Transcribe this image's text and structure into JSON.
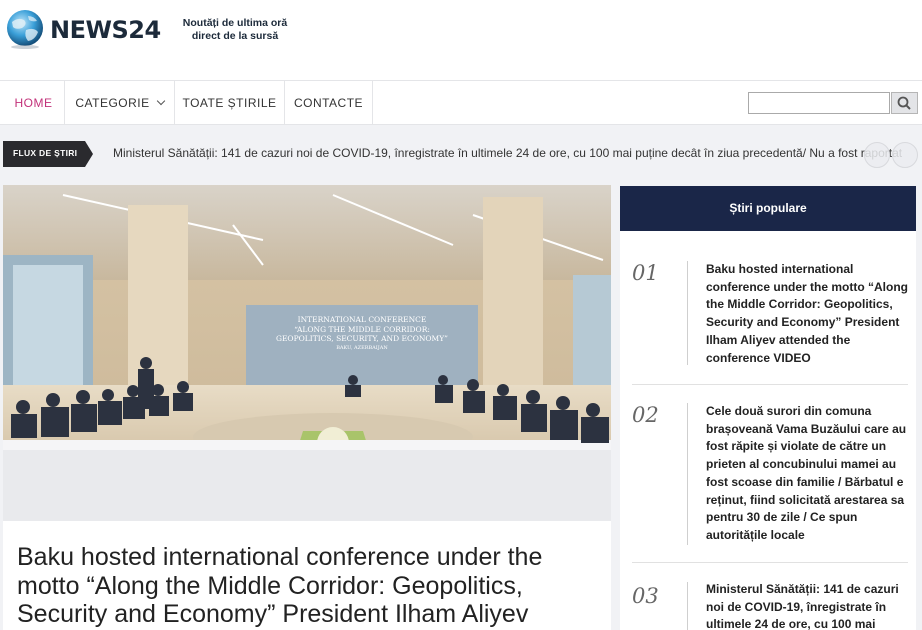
{
  "header": {
    "logo": "NEWS24",
    "tagline_1": "Noutăți de ultima oră",
    "tagline_2": "direct de la sursă"
  },
  "nav": {
    "items": [
      "HOME",
      "CATEGORIE",
      "TOATE ȘTIRILE",
      "CONTACTE"
    ],
    "active": "HOME",
    "search_value": ""
  },
  "ticker": {
    "label": "FLUX DE ȘTIRI",
    "text": "Ministerul Sănătății: 141 de cazuri noi de COVID-19, înregistrate în ultimele 24 de ore, cu 100 mai puține decât în ziua precedentă/ Nu a fost raportat"
  },
  "featured": {
    "image_banner_1": "INTERNATIONAL CONFERENCE",
    "image_banner_2": "“ALONG THE MIDDLE CORRIDOR:",
    "image_banner_3": "GEOPOLITICS, SECURITY, AND ECONOMY”",
    "image_banner_4": "BAKU, AZERBAIJAN",
    "title": "Baku hosted international conference under the motto “Along the Middle Corridor: Geopolitics, Security and Economy” President Ilham Aliyev"
  },
  "popular": {
    "header": "Știri populare",
    "items": [
      {
        "num": "01",
        "text": "Baku hosted international conference under the motto “Along the Middle Corridor: Geopolitics, Security and Economy” President Ilham Aliyev attended the conference VIDEO"
      },
      {
        "num": "02",
        "text": "Cele două surori din comuna brașoveană Vama Buzăului care au fost răpite și violate de către un prieten al concubinului mamei au fost scoase din familie / Bărbatul e reținut, fiind solicitată arestarea sa pentru 30 de zile / Ce spun autoritățile locale"
      },
      {
        "num": "03",
        "text": "Ministerul Sănătății: 141 de cazuri noi de COVID-19, înregistrate în ultimele 24 de ore, cu 100 mai"
      }
    ]
  },
  "colors": {
    "accent": "#c2327a",
    "navy": "#1a2648",
    "ticker_label_bg": "#2a2a2e"
  }
}
